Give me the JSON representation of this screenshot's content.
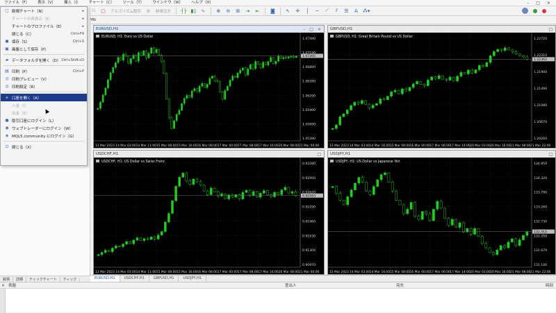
{
  "menubar": {
    "items": [
      "ファイル（F）",
      "表示（V）",
      "挿入（I）",
      "チャート（C）",
      "ツール（T）",
      "ウインドウ（W）",
      "ヘルプ（H）"
    ],
    "window_controls": [
      "–",
      "□",
      "×"
    ]
  },
  "toolbar": {
    "algo_trading_label": "アルゴリズム取引",
    "new_order_label": "新規注文"
  },
  "timeframe": {
    "current": "MN"
  },
  "file_menu": {
    "items": [
      {
        "icon": "new-chart-icon",
        "glyph": "▢",
        "label": "新規チャート（N）",
        "shortcut": "",
        "arrow": true,
        "disabled": false
      },
      {
        "icon": "",
        "glyph": "",
        "label": "チャートの再表示（E）",
        "shortcut": "",
        "arrow": true,
        "disabled": true
      },
      {
        "icon": "",
        "glyph": "",
        "label": "チャートのプロファイル（E）",
        "shortcut": "",
        "arrow": true,
        "disabled": false
      },
      {
        "icon": "",
        "glyph": "",
        "label": "閉じる（C）",
        "shortcut": "Ctrl+F4",
        "arrow": false,
        "disabled": false
      },
      {
        "icon": "save-icon",
        "glyph": "◼",
        "label": "保存（S）",
        "shortcut": "Ctrl+S",
        "arrow": false,
        "disabled": false
      },
      {
        "icon": "save-image-icon",
        "glyph": "▣",
        "label": "画像として保存（P）",
        "shortcut": "",
        "arrow": false,
        "disabled": false
      },
      {
        "sep": true
      },
      {
        "icon": "folder-icon",
        "glyph": "▰",
        "label": "データフォルダを開く（D）",
        "shortcut": "Ctrl+Shift+D",
        "arrow": false,
        "disabled": false
      },
      {
        "sep": true
      },
      {
        "icon": "print-icon",
        "glyph": "▤",
        "label": "印刷（P）",
        "shortcut": "Ctrl+P",
        "arrow": false,
        "disabled": false
      },
      {
        "icon": "print-preview-icon",
        "glyph": "◎",
        "label": "印刷プレビュー（V）",
        "shortcut": "",
        "arrow": false,
        "disabled": false
      },
      {
        "icon": "print-setup-icon",
        "glyph": "◎",
        "label": "印刷設定（R）",
        "shortcut": "",
        "arrow": false,
        "disabled": false
      },
      {
        "sep": true
      },
      {
        "icon": "open-account-icon",
        "glyph": "＋",
        "label": "口座を開く（A）",
        "shortcut": "",
        "arrow": false,
        "disabled": false,
        "highlight": true
      },
      {
        "icon": "deposit-icon",
        "glyph": "",
        "label": "入金（I）",
        "shortcut": "",
        "arrow": false,
        "disabled": true
      },
      {
        "icon": "withdraw-icon",
        "glyph": "",
        "label": "出金（E）",
        "shortcut": "",
        "arrow": false,
        "disabled": true
      },
      {
        "icon": "login-trade-icon",
        "glyph": "●",
        "label": "取引口座にログイン（L）",
        "shortcut": "",
        "arrow": false,
        "disabled": false
      },
      {
        "icon": "web-trader-icon",
        "glyph": "◉",
        "label": "ウェブトレーダーにログイン（W）",
        "shortcut": "",
        "arrow": false,
        "disabled": false
      },
      {
        "icon": "mql5-community-icon",
        "glyph": "◈",
        "label": "MQL5.community にログイン（G）",
        "shortcut": "",
        "arrow": false,
        "disabled": false
      },
      {
        "sep": true
      },
      {
        "icon": "exit-icon",
        "glyph": "⏻",
        "label": "閉じる（X）",
        "shortcut": "",
        "arrow": false,
        "disabled": false
      }
    ]
  },
  "left_panel_tabs": [
    "銘柄",
    "詳細",
    "ティックチャート",
    "ティック"
  ],
  "charts": [
    {
      "window_title": "EURUSD,H1",
      "info": "EURUSD, H1:  Euro vs US Dollar",
      "active": true,
      "price_labels": [
        "1.07490",
        "1.07190",
        "1.06890",
        "1.06590",
        "1.06290",
        "1.05990",
        "1.05690",
        "1.05390"
      ],
      "current_price": "1.07265",
      "time_labels": [
        "13 Mar 2023",
        "14 Mar 03:00",
        "14 Mar 11:00",
        "15 Mar 08:00",
        "15 Mar 16:00",
        "16 Mar 08:00",
        "17 Mar 00:00",
        "17 Mar 08:00",
        "17 Mar 16:00",
        "20 Mar 08:00",
        "21 Mar 00:00"
      ],
      "series": [
        1.0585,
        1.0602,
        1.0621,
        1.064,
        1.0662,
        1.0681,
        1.0695,
        1.0708,
        1.0722,
        1.0715,
        1.0731,
        1.0726,
        1.0706,
        1.0719,
        1.0728,
        1.0712,
        1.0735,
        1.0728,
        1.074,
        1.0721,
        1.0733,
        1.0748,
        1.0735,
        1.0744,
        1.0728,
        1.0712,
        1.068,
        1.061,
        1.056,
        1.0531,
        1.0552,
        1.0569,
        1.058,
        1.0598,
        1.0612,
        1.062,
        1.0615,
        1.0632,
        1.0638,
        1.063,
        1.0645,
        1.0652,
        1.0641,
        1.065,
        1.0666,
        1.0672,
        1.066,
        1.0658,
        1.0629,
        1.061,
        1.0633,
        1.0645,
        1.0661,
        1.0672,
        1.0668,
        1.068,
        1.0688,
        1.0694,
        1.0675,
        1.0691,
        1.0703,
        1.0692,
        1.0711,
        1.0704,
        1.0695,
        1.0709,
        1.0702,
        1.0711,
        1.0722,
        1.0705,
        1.0712,
        1.0726,
        1.0719,
        1.0722,
        1.072,
        1.0724,
        1.0725,
        1.0722,
        1.0726
      ]
    },
    {
      "window_title": "GBPUSD,H1",
      "info": "GBPUSD, H1:  Great Britain Pound vs US Dollar",
      "active": false,
      "price_labels": [
        "1.22720",
        "1.22310",
        "1.21900",
        "1.21490",
        "1.21080",
        "1.20670",
        "1.20260"
      ],
      "current_price": "1.22362",
      "time_labels": [
        "13 Mar 2023",
        "14 Mar 03:00",
        "14 Mar 16:00",
        "15 Mar 08:00",
        "16 Mar 00:00",
        "17 Mar 06:00",
        "17 Mar 14:00",
        "20 Mar 03:00",
        "20 Mar 16:00",
        "21 Mar 08:00",
        "21 Mar 22:00"
      ],
      "series": [
        1.2,
        1.2012,
        1.204,
        1.205,
        1.2063,
        1.2078,
        1.209,
        1.2085,
        1.2095,
        1.2082,
        1.207,
        1.2079,
        1.2085,
        1.2101,
        1.2098,
        1.211,
        1.2125,
        1.213,
        1.2118,
        1.2135,
        1.2128,
        1.214,
        1.2152,
        1.216,
        1.215,
        1.2146,
        1.2165,
        1.2176,
        1.217,
        1.218,
        1.2168,
        1.2165,
        1.2175,
        1.2162,
        1.2178,
        1.2191,
        1.2186,
        1.2199,
        1.2189,
        1.22,
        1.2215,
        1.2211,
        1.2225,
        1.2248,
        1.2262,
        1.227,
        1.2266,
        1.2275,
        1.2268,
        1.2262,
        1.2255,
        1.2248,
        1.2244,
        1.2236
      ]
    },
    {
      "window_title": "USDCHF,H1",
      "info": "USDCHF, H1:  US Dollar vs Swiss Franc",
      "active": false,
      "price_labels": [
        "0.93280",
        "0.92950",
        "0.92620",
        "0.92290",
        "0.91960",
        "0.91630",
        "0.91300",
        "0.90970"
      ],
      "current_price": "0.92593",
      "time_labels": [
        "13 Mar 2023",
        "14 Mar 03:00",
        "14 Mar 11:00",
        "15 Mar 08:00",
        "15 Mar 16:00",
        "16 Mar 08:00",
        "17 Mar 00:00",
        "17 Mar 08:00",
        "17 Mar 16:00",
        "20 Mar 08:00",
        "21 Mar 00:00"
      ],
      "series": [
        0.9096,
        0.9102,
        0.9108,
        0.9104,
        0.9114,
        0.912,
        0.9118,
        0.9125,
        0.9132,
        0.9126,
        0.9136,
        0.9142,
        0.9135,
        0.914,
        0.9138,
        0.9145,
        0.9139,
        0.915,
        0.916,
        0.9186,
        0.921,
        0.9245,
        0.9285,
        0.931,
        0.9322,
        0.93,
        0.929,
        0.9305,
        0.9298,
        0.9288,
        0.9272,
        0.9262,
        0.928,
        0.927,
        0.9258,
        0.9264,
        0.925,
        0.9261,
        0.9255,
        0.9262,
        0.925,
        0.9268,
        0.9274,
        0.926,
        0.927,
        0.9255,
        0.9266,
        0.9273,
        0.9262,
        0.9256,
        0.9268,
        0.9262,
        0.9275,
        0.9282,
        0.9266,
        0.927,
        0.9259
      ]
    },
    {
      "window_title": "USDJPY,H1",
      "info": "USDJPY, H1:  US Dollar vs Japanese Yen",
      "active": false,
      "price_labels": [
        "134.850",
        "134.320",
        "133.790",
        "133.260",
        "132.730",
        "132.200",
        "131.670",
        "131.140"
      ],
      "current_price": "132.415",
      "time_labels": [
        "13 Mar 2023",
        "14 Mar 03:00",
        "14 Mar 16:00",
        "15 Mar 08:00",
        "16 Mar 00:00",
        "17 Mar 06:00",
        "17 Mar 14:00",
        "20 Mar 03:00",
        "20 Mar 16:00",
        "21 Mar 08:00",
        "21 Mar 22:00"
      ],
      "series": [
        134.4,
        134.1,
        133.8,
        133.6,
        133.95,
        134.25,
        134.55,
        134.8,
        134.6,
        134.2,
        134.05,
        134.4,
        134.7,
        134.92,
        135.0,
        134.6,
        134.2,
        133.8,
        133.6,
        133.2,
        133.4,
        133.7,
        133.1,
        132.95,
        133.3,
        133.2,
        132.9,
        133.4,
        133.75,
        133.45,
        133.0,
        132.7,
        132.95,
        132.6,
        132.8,
        132.4,
        132.55,
        132.3,
        132.55,
        132.2,
        131.9,
        131.7,
        131.5,
        131.4,
        131.6,
        131.8,
        131.7,
        131.95,
        132.1,
        131.8,
        132.05,
        132.25,
        132.4
      ]
    }
  ],
  "sheet_tabs": [
    "EURUSD,H1",
    "USDCHF,H1",
    "GBPUSD,H1",
    "USDJPY,H1"
  ],
  "toolbox": {
    "columns": [
      "表題",
      "差出人",
      "宛先",
      "時刻"
    ]
  },
  "colors": {
    "bull": "#22cc22",
    "bear": "#c8c8c8",
    "line": "#1fbf1f",
    "grid": "#2c2c2c",
    "highlight": "#1e3a8a"
  }
}
